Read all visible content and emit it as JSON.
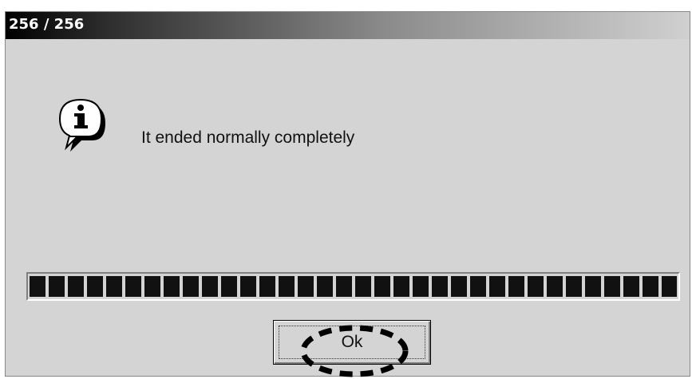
{
  "window": {
    "title": "256 / 256"
  },
  "dialog": {
    "icon": "info-icon",
    "message": "It ended normally completely",
    "progress": 1.0
  },
  "buttons": {
    "ok_label": "Ok"
  },
  "colors": {
    "dialog_bg": "#d4d4d4",
    "progress_block": "#111111",
    "title_text": "#ffffff"
  }
}
